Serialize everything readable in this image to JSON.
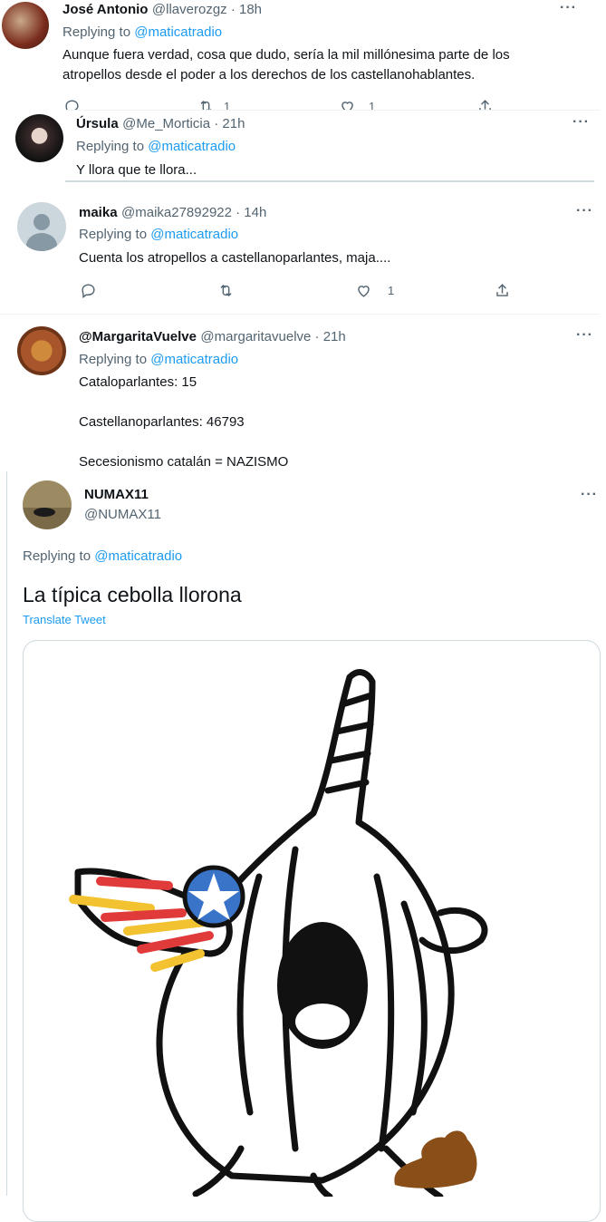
{
  "tweets": [
    {
      "name": "José Antonio",
      "handle": "@llaverozgz · 18h",
      "replying_prefix": "Replying to ",
      "replying_to": "@maticatradio",
      "text_lines": [
        "Aunque fuera verdad, cosa que dudo, sería la mil millónesima parte de los",
        "atropellos desde el poder a los derechos de los  castellanohablantes."
      ],
      "retweets": "1",
      "likes": "1"
    },
    {
      "name": "Úrsula",
      "handle": "@Me_Morticia · 21h",
      "replying_prefix": "Replying to ",
      "replying_to": "@maticatradio",
      "text": "Y llora que te llora..."
    },
    {
      "name": "maika",
      "handle": "@maika27892922 · 14h",
      "replying_prefix": "Replying to ",
      "replying_to": "@maticatradio",
      "text": "Cuenta los atropellos a castellanoparlantes, maja....",
      "likes": "1"
    },
    {
      "name": "@MargaritaVuelve",
      "handle": "@margaritavuelve · 21h",
      "replying_prefix": "Replying to ",
      "replying_to": "@maticatradio",
      "lines": [
        "Cataloparlantes: 15",
        "Castellanoparlantes: 46793",
        "Secesionismo catalán = NAZISMO"
      ]
    }
  ],
  "main_tweet": {
    "name": "NUMAX11",
    "handle": "@NUMAX11",
    "replying_prefix": "Replying to ",
    "replying_to": "@maticatradio",
    "text": "La típica cebolla llorona",
    "translate": "Translate Tweet",
    "image_icon": "crying-onion-illustration"
  },
  "colors": {
    "link": "#1d9bf0",
    "secondary": "#536471",
    "text": "#0f1419"
  }
}
